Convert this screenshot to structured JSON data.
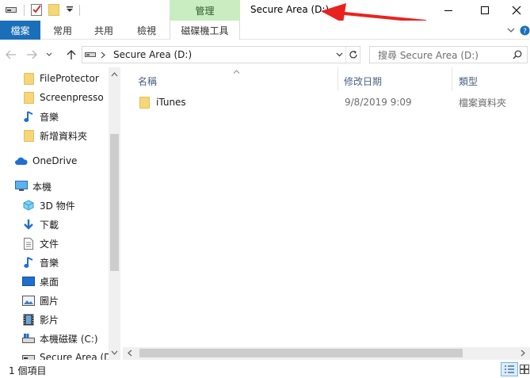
{
  "titlebar": {
    "context_tab": "管理",
    "title": "Secure Area (D:)"
  },
  "ribbon": {
    "tabs": [
      "檔案",
      "常用",
      "共用",
      "檢視",
      "磁碟機工具"
    ]
  },
  "address": {
    "path": "Secure Area (D:)",
    "search_placeholder": "搜尋 Secure Area (D:)"
  },
  "sidebar": {
    "quick_access": [
      "FileProtector",
      "Screenpresso",
      "音樂",
      "新增資料夾"
    ],
    "onedrive": "OneDrive",
    "this_pc": "本機",
    "pc_items": [
      "3D 物件",
      "下載",
      "文件",
      "音樂",
      "桌面",
      "圖片",
      "影片",
      "本機磁碟 (C:)",
      "Secure Area (D:)"
    ]
  },
  "columns": {
    "name": "名稱",
    "modified": "修改日期",
    "type": "類型"
  },
  "files": [
    {
      "name": "iTunes",
      "modified": "9/8/2019 9:09",
      "type": "檔案資料夾"
    }
  ],
  "status": {
    "count": "1 個項目"
  },
  "colors": {
    "file_tab": "#1a6fb8",
    "context_tab": "#c9ecc0",
    "annotation_arrow": "#e8231f",
    "folder": "#f5d77a"
  }
}
